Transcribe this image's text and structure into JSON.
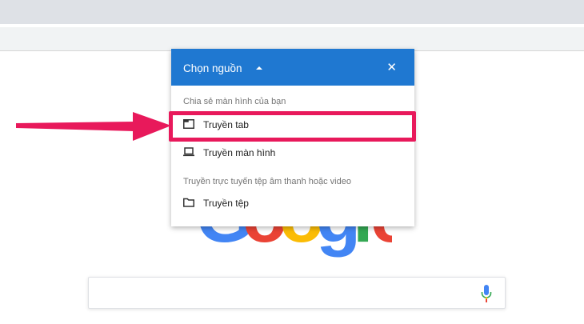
{
  "dialog": {
    "title": "Chọn nguồn",
    "close_glyph": "✕",
    "section_share": "Chia sẻ màn hình của bạn",
    "section_stream": "Truyền trực tuyến tệp âm thanh hoặc video",
    "options": [
      {
        "label": "Truyền tab",
        "icon": "tab-icon"
      },
      {
        "label": "Truyền màn hình",
        "icon": "laptop-icon"
      },
      {
        "label": "Truyền tệp",
        "icon": "folder-icon"
      }
    ]
  },
  "logo": {
    "letters": [
      "G",
      "o",
      "o",
      "g",
      "l",
      "e"
    ]
  },
  "colors": {
    "dialog_header": "#1f78d1",
    "highlight": "#e8195b",
    "google_blue": "#4285f4",
    "google_red": "#ea4335",
    "google_yellow": "#fbbc05",
    "google_green": "#34a853"
  }
}
